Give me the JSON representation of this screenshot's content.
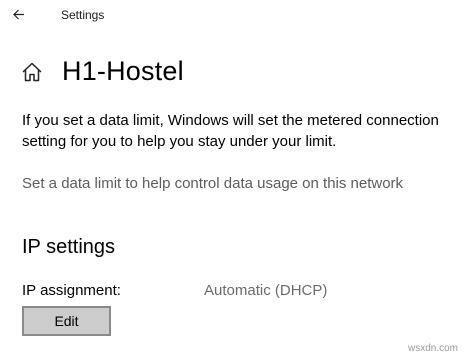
{
  "window": {
    "app_title": "Settings"
  },
  "header": {
    "page_title": "H1-Hostel"
  },
  "content": {
    "info_text": "If you set a data limit, Windows will set the metered connection setting for you to help you stay under your limit.",
    "data_limit_link": "Set a data limit to help control data usage on this network"
  },
  "ip_settings": {
    "section_title": "IP settings",
    "assignment_label": "IP assignment:",
    "assignment_value": "Automatic (DHCP)",
    "edit_button_label": "Edit"
  },
  "watermark": "wsxdn.com",
  "icons": {
    "back": "back-arrow-icon",
    "home": "home-icon"
  },
  "colors": {
    "button_bg": "#cccccc",
    "button_border": "#8a8a8a",
    "muted_text": "#5c5c5c"
  }
}
